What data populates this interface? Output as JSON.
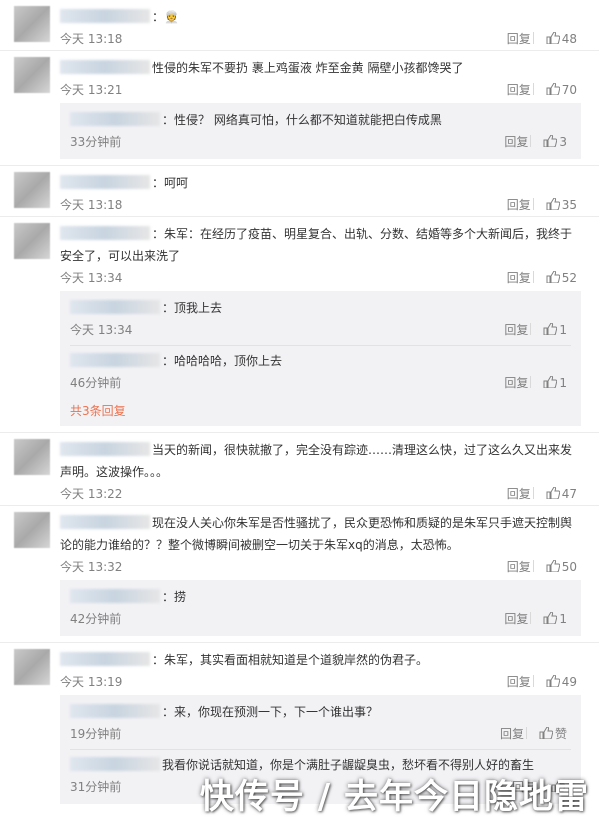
{
  "reply_label": "回复",
  "comments": [
    {
      "text": "：👳",
      "time": "今天 13:18",
      "likes": "48",
      "replies": []
    },
    {
      "text": "性侵的朱军不要扔 裹上鸡蛋液 炸至金黄 隔壁小孩都馋哭了",
      "time": "今天 13:21",
      "likes": "70",
      "replies": [
        {
          "text": "：性侵？ 网络真可怕，什么都不知道就能把白传成黑",
          "time": "33分钟前",
          "likes": "3"
        }
      ]
    },
    {
      "text": "：呵呵",
      "time": "今天 13:18",
      "likes": "35",
      "replies": []
    },
    {
      "text": "：朱军：在经历了疫苗、明星复合、出轨、分数、结婚等多个大新闻后，我终于安全了，可以出来洗了",
      "time": "今天 13:34",
      "likes": "52",
      "replies": [
        {
          "text": "：顶我上去",
          "time": "今天 13:34",
          "likes": "1"
        },
        {
          "text": "：哈哈哈哈，顶你上去",
          "time": "46分钟前",
          "likes": "1"
        }
      ],
      "more": "共3条回复"
    },
    {
      "text": "当天的新闻，很快就撤了，完全没有踪迹……清理这么快，过了这么久又出来发声明。这波操作。。。",
      "time": "今天 13:22",
      "likes": "47",
      "replies": []
    },
    {
      "text": "现在没人关心你朱军是否性骚扰了，民众更恐怖和质疑的是朱军只手遮天控制舆论的能力谁给的？？整个微博瞬间被删空一切关于朱军xq的消息，太恐怖。",
      "time": "今天 13:32",
      "likes": "50",
      "replies": [
        {
          "text": "：捞",
          "time": "42分钟前",
          "likes": "1"
        }
      ]
    },
    {
      "text": "：朱军，其实看面相就知道是个道貌岸然的伪君子。",
      "time": "今天 13:19",
      "likes": "49",
      "replies": [
        {
          "text": "：来，你现在预测一下，下一个谁出事？",
          "time": "19分钟前",
          "likes": "赞"
        },
        {
          "text": "我看你说话就知道，你是个满肚子龌龊臭虫，愁坏看不得别人好的畜生",
          "time": "31分钟前",
          "likes": ""
        }
      ]
    }
  ],
  "watermark": "快传号 / 去年今日隐地雷"
}
